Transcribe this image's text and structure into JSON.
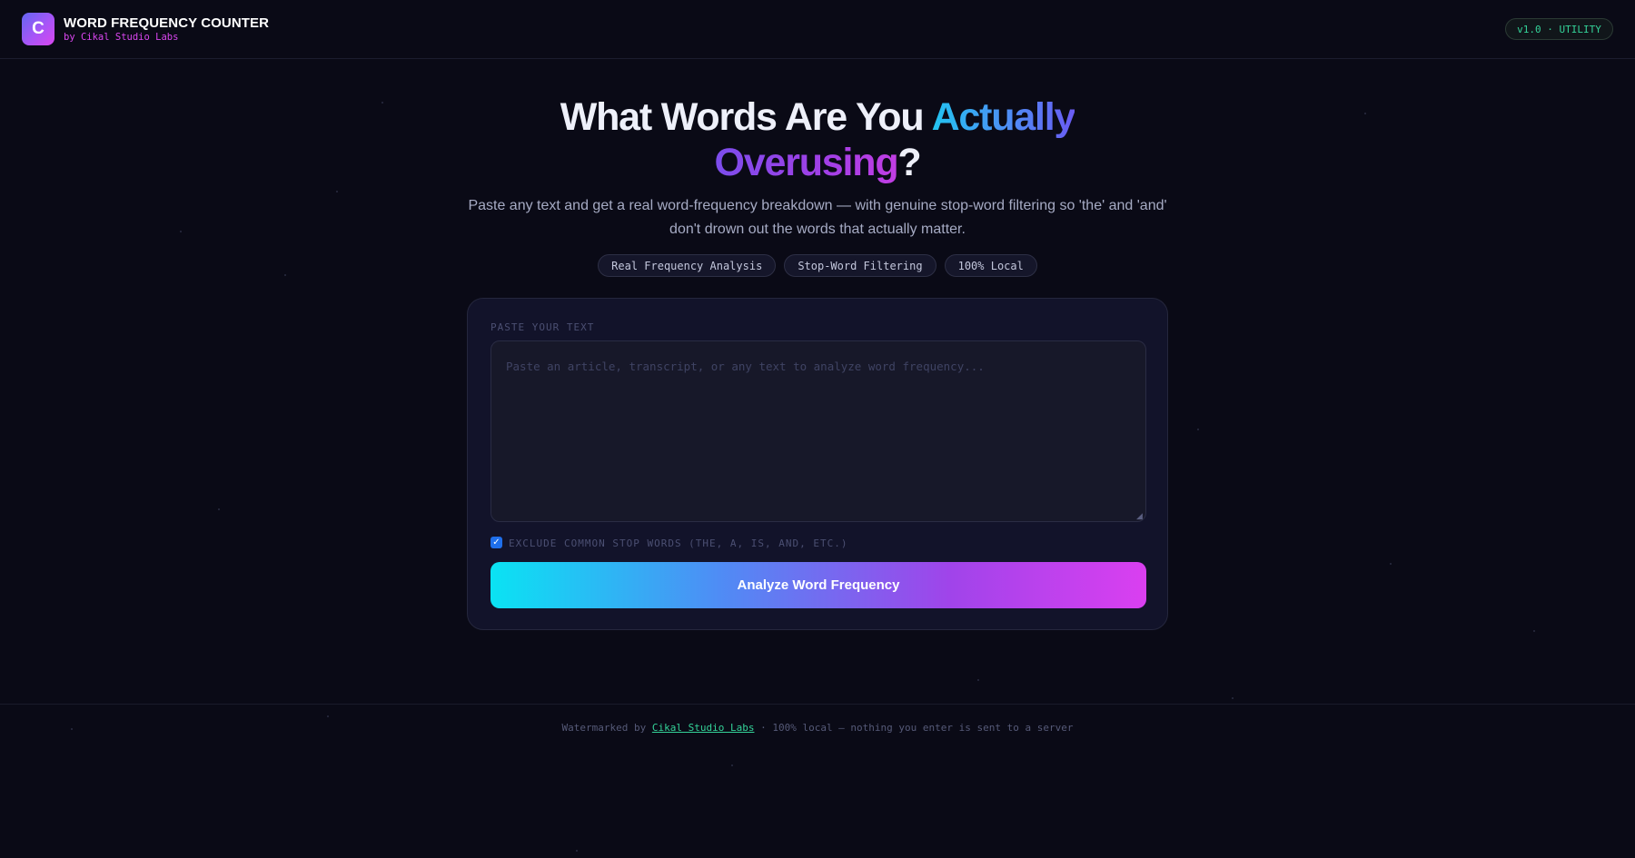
{
  "header": {
    "logo_letter": "C",
    "title": "WORD FREQUENCY COUNTER",
    "subtitle": "by Cikal Studio Labs",
    "version_badge": "v1.0 · UTILITY"
  },
  "hero": {
    "title_part1": "What Words Are You ",
    "title_highlight1": "Actually",
    "title_highlight2": "Overusing",
    "title_end": "?",
    "description": "Paste any text and get a real word-frequency breakdown — with genuine stop-word filtering so 'the' and 'and' don't drown out the words that actually matter.",
    "chips": [
      "Real Frequency Analysis",
      "Stop-Word Filtering",
      "100% Local"
    ]
  },
  "form": {
    "label": "PASTE YOUR TEXT",
    "textarea_value": "",
    "textarea_placeholder": "Paste an article, transcript, or any text to analyze word frequency...",
    "checkbox_checked": true,
    "checkbox_label": "EXCLUDE COMMON STOP WORDS (THE, A, IS, AND, ETC.)",
    "button_label": "Analyze Word Frequency"
  },
  "footer": {
    "prefix": "Watermarked by ",
    "link_text": "Cikal Studio Labs",
    "suffix": " · 100% local — nothing you enter is sent to a server"
  },
  "colors": {
    "background": "#0a0a16",
    "accent_cyan": "#22c4f0",
    "accent_purple": "#a855f7",
    "accent_pink": "#d946ef",
    "accent_green": "#34d399",
    "checkbox_blue": "#1f6feb"
  },
  "icons": {
    "logo": "c-logo-icon",
    "checkbox": "check-icon",
    "resize": "resize-grip-icon"
  }
}
